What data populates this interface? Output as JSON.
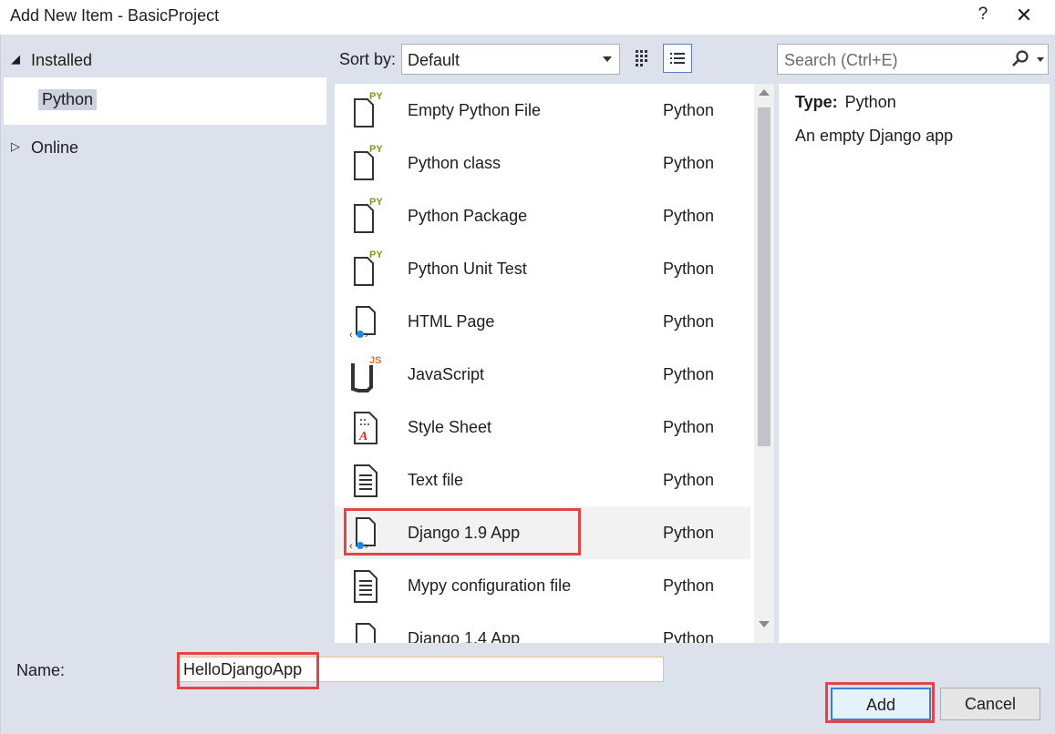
{
  "window": {
    "title": "Add New Item - BasicProject",
    "help_label": "?",
    "close_label": "✕"
  },
  "tree": {
    "installed": "Installed",
    "python": "Python",
    "online": "Online"
  },
  "toolbar": {
    "sort_label": "Sort by:",
    "sort_value": "Default",
    "search_placeholder": "Search (Ctrl+E)"
  },
  "items": [
    {
      "name": "Empty Python File",
      "type": "Python",
      "icon": "py-file-icon"
    },
    {
      "name": "Python class",
      "type": "Python",
      "icon": "py-file-icon"
    },
    {
      "name": "Python Package",
      "type": "Python",
      "icon": "py-file-icon"
    },
    {
      "name": "Python Unit Test",
      "type": "Python",
      "icon": "py-file-icon"
    },
    {
      "name": "HTML Page",
      "type": "Python",
      "icon": "html-file-icon"
    },
    {
      "name": "JavaScript",
      "type": "Python",
      "icon": "js-file-icon"
    },
    {
      "name": "Style Sheet",
      "type": "Python",
      "icon": "css-file-icon"
    },
    {
      "name": "Text file",
      "type": "Python",
      "icon": "text-file-icon"
    },
    {
      "name": "Django 1.9 App",
      "type": "Python",
      "icon": "web-file-icon",
      "selected": true
    },
    {
      "name": "Mypy configuration file",
      "type": "Python",
      "icon": "text-file-icon"
    },
    {
      "name": "Django 1.4 App",
      "type": "Python",
      "icon": "web-file-icon"
    }
  ],
  "details": {
    "type_label": "Type:",
    "type_value": "Python",
    "description": "An empty Django app"
  },
  "footer": {
    "name_label": "Name:",
    "name_value": "HelloDjangoApp",
    "add_label": "Add",
    "cancel_label": "Cancel"
  },
  "colors": {
    "highlight_box": "#e04646",
    "py_badge": "#7a9a22",
    "js_badge": "#e8742a",
    "web_dot": "#1e88e5"
  }
}
